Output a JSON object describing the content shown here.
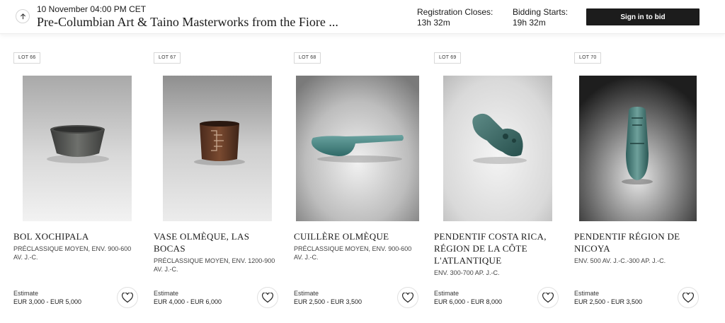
{
  "header": {
    "up_icon": "arrow-up-icon",
    "date": "10 November 04:00 PM CET",
    "title": "Pre-Columbian Art & Taino Masterworks from the Fiore ...",
    "registration_label": "Registration Closes:",
    "registration_value": "13h 32m",
    "bidding_label": "Bidding Starts:",
    "bidding_value": "19h 32m",
    "signin_label": "Sign in to bid"
  },
  "lots": [
    {
      "badge": "LOT 66",
      "title": "BOL XOCHIPALA",
      "subtitle": "PRÉCLASSIQUE MOYEN, ENV. 900-600 AV. J.-C.",
      "estimate_label": "Estimate",
      "estimate": "EUR 3,000 - EUR 5,000"
    },
    {
      "badge": "LOT 67",
      "title": "VASE OLMÈQUE, LAS BOCAS",
      "subtitle": "PRÉCLASSIQUE MOYEN, ENV. 1200-900 AV. J.-C.",
      "estimate_label": "Estimate",
      "estimate": "EUR 4,000 - EUR 6,000"
    },
    {
      "badge": "LOT 68",
      "title": "CUILLÈRE OLMÈQUE",
      "subtitle": "PRÉCLASSIQUE MOYEN, ENV. 900-600 AV. J.-C.",
      "estimate_label": "Estimate",
      "estimate": "EUR 2,500 - EUR 3,500"
    },
    {
      "badge": "LOT 69",
      "title": "PENDENTIF COSTA RICA, RÉGION DE LA CÔTE L'ATLANTIQUE",
      "subtitle": "ENV. 300-700 AP. J.-C.",
      "estimate_label": "Estimate",
      "estimate": "EUR 6,000 - EUR 8,000"
    },
    {
      "badge": "LOT 70",
      "title": "PENDENTIF RÉGION DE NICOYA",
      "subtitle": "ENV. 500 AV. J.-C.-300 AP. J.-C.",
      "estimate_label": "Estimate",
      "estimate": "EUR 2,500 - EUR 3,500"
    }
  ],
  "icons": {
    "favorite": "heart-icon"
  }
}
